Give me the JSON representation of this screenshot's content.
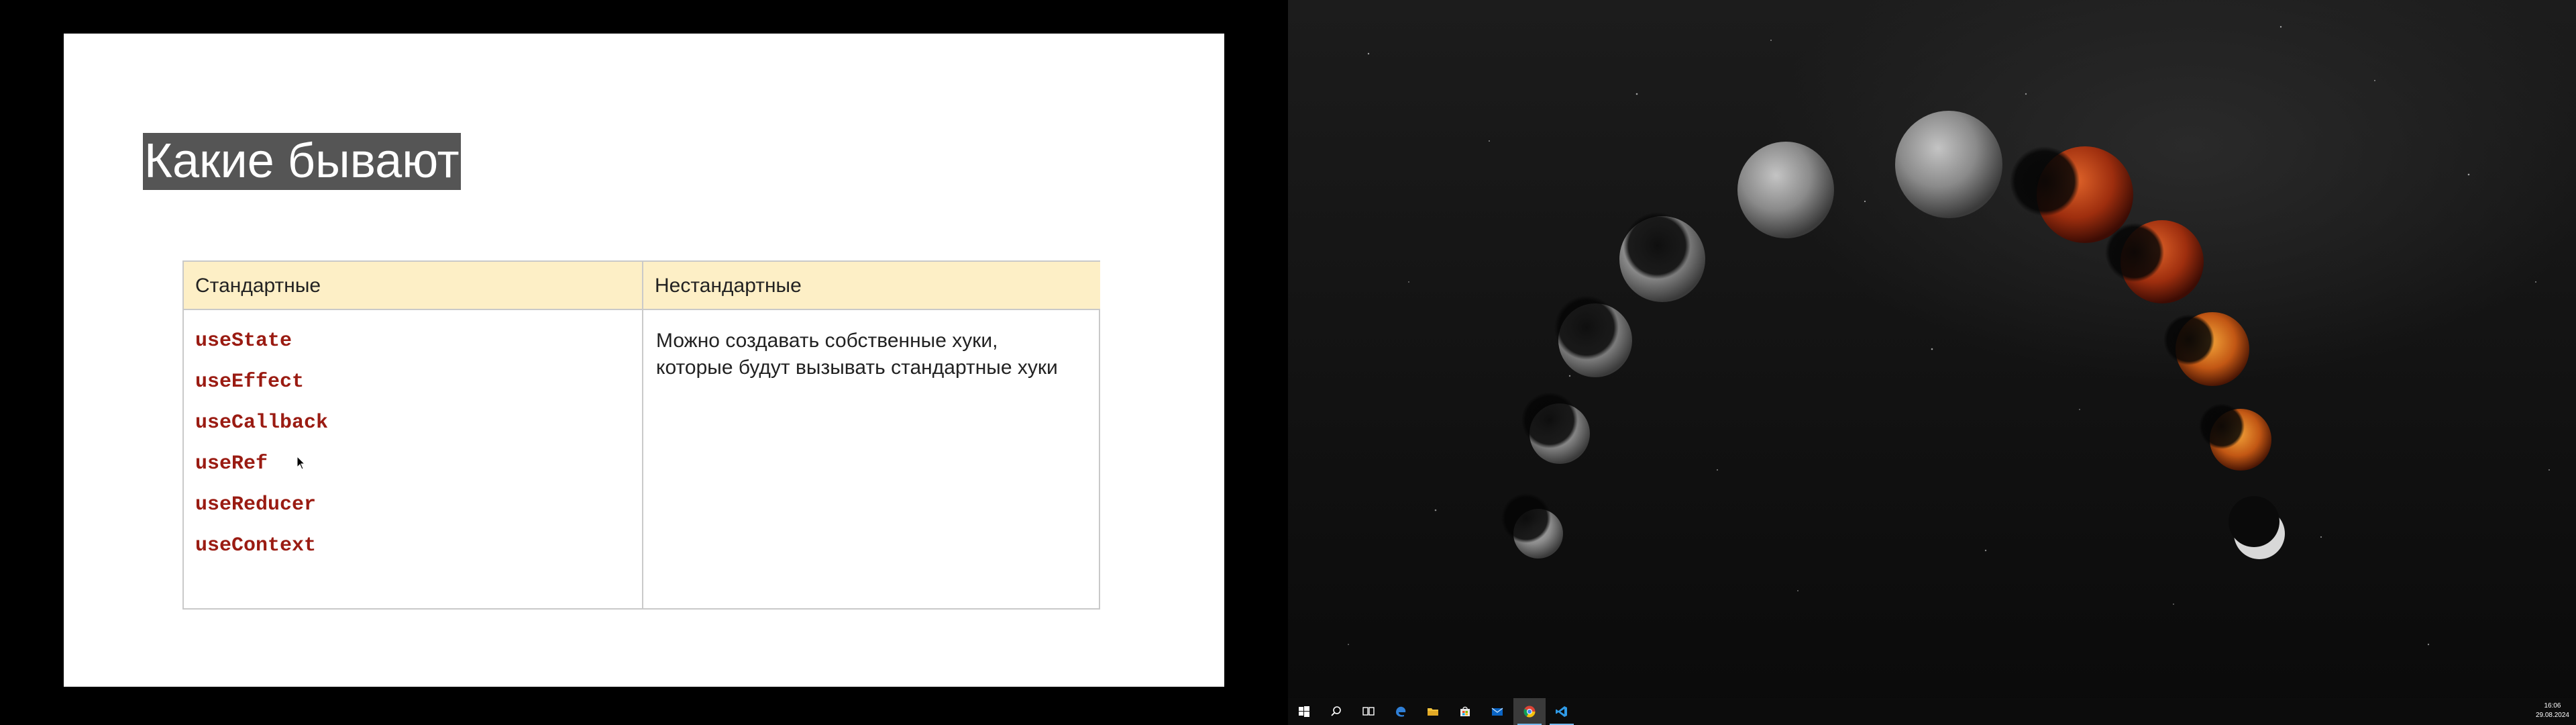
{
  "slide": {
    "title": "Какие бывают",
    "table": {
      "headers": [
        "Стандартные",
        "Нестандартные"
      ],
      "standard_hooks": [
        "useState",
        "useEffect",
        "useCallback",
        "useRef",
        "useReducer",
        "useContext"
      ],
      "custom_description": "Можно создавать собственные хуки, которые будут вызывать стандартные хуки"
    }
  },
  "taskbar": {
    "icons": [
      "windows-start-icon",
      "search-icon",
      "task-view-icon",
      "edge-icon",
      "file-explorer-icon",
      "store-icon",
      "mail-icon",
      "chrome-icon",
      "vscode-icon"
    ],
    "clock": {
      "time": "16:06",
      "date": "29.08.2024"
    }
  },
  "colors": {
    "header_bg": "#fdefc6",
    "code_text": "#9a1b12",
    "title_bg": "#555555",
    "taskbar_bg": "#0c0c0c",
    "active_indicator": "#76b9ed"
  }
}
